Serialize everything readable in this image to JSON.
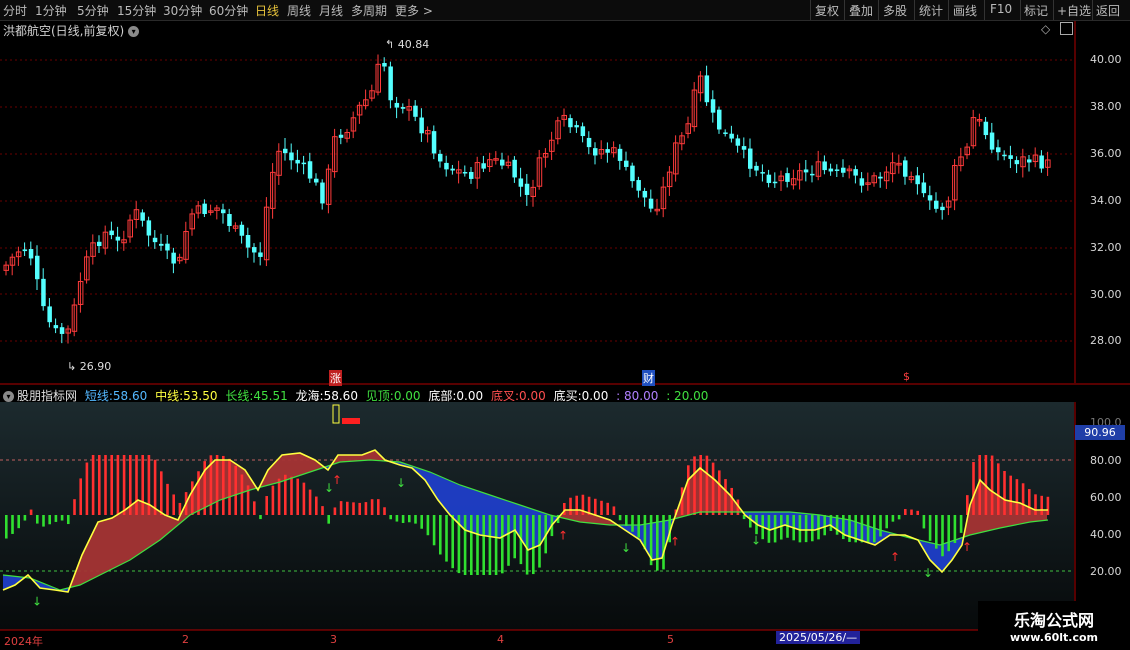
{
  "topbar": {
    "tabs": [
      "分时",
      "1分钟",
      "5分钟",
      "15分钟",
      "30分钟",
      "60分钟",
      "日线",
      "周线",
      "月线",
      "多周期",
      "更多 >"
    ],
    "active_tab": "日线",
    "right_buttons": [
      "复权",
      "叠加",
      "多股",
      "统计",
      "画线",
      "F10",
      "标记",
      "+自选",
      "返回"
    ]
  },
  "stock": {
    "title": "洪都航空(日线,前复权)",
    "high_label": "40.84",
    "low_label": "26.90"
  },
  "price_axis": {
    "labels": [
      "40.00",
      "38.00",
      "36.00",
      "34.00",
      "32.00",
      "30.00",
      "28.00"
    ]
  },
  "markers": {
    "zhang": "涨",
    "cai": "财",
    "dollar": "$"
  },
  "indicator": {
    "name": "股朋指标网",
    "short_label": "短线:",
    "short_val": "58.60",
    "mid_label": "中线:",
    "mid_val": "53.50",
    "long_label": "长线:",
    "long_val": "45.51",
    "dragon_label": "龙海:",
    "dragon_val": "58.60",
    "top_label": "见顶:",
    "top_val": "0.00",
    "bottom_label": "底部:",
    "bottom_val": "0.00",
    "cross_label": "底叉:",
    "cross_val": "0.00",
    "buy_label": "底买:",
    "buy_val": "0.00",
    "p80": ": 80.00",
    "p20": ": 20.00",
    "current_value": "90.96",
    "axis_labels": [
      "100.0",
      "80.00",
      "60.00",
      "40.00",
      "20.00"
    ]
  },
  "date_axis": {
    "labels": [
      "2024年",
      "2",
      "3",
      "4",
      "5"
    ],
    "selected": "2025/05/26/—"
  },
  "watermark": {
    "title": "乐淘公式网",
    "url": "www.60lt.com"
  },
  "colors": {
    "up": "#ff3b3b",
    "down": "#54ffff",
    "short": "#ffff40",
    "long": "#40e040",
    "axis": "#b00000"
  }
}
